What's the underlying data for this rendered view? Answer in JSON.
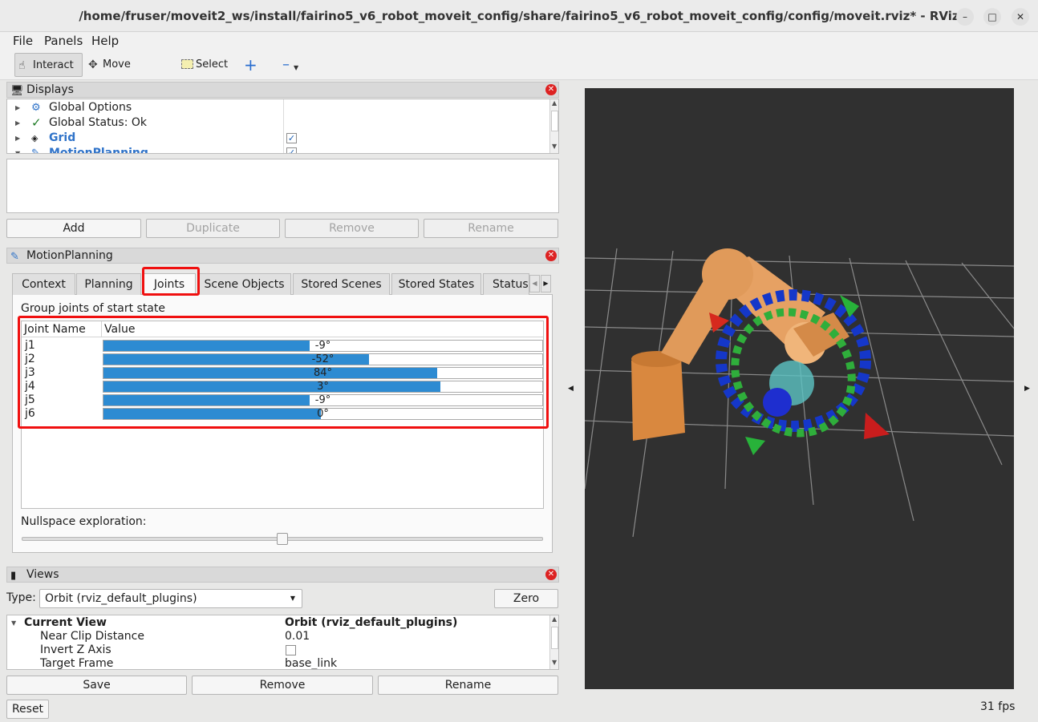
{
  "window": {
    "title": "/home/fruser/moveit2_ws/install/fairino5_v6_robot_moveit_config/share/fairino5_v6_robot_moveit_config/config/moveit.rviz* - RViz"
  },
  "menu": {
    "file": "File",
    "panels": "Panels",
    "help": "Help"
  },
  "toolbar": {
    "interact": "Interact",
    "move_camera": "Move Camera",
    "select": "Select",
    "add_icon": "plus-icon",
    "remove_icon": "minus-icon"
  },
  "displays": {
    "title": "Displays",
    "items": [
      {
        "label": "Global Options",
        "icon": "gear-icon",
        "checked": null
      },
      {
        "label": "Global Status: Ok",
        "icon": "checkmark-icon",
        "checked": null
      },
      {
        "label": "Grid",
        "icon": "grid-icon",
        "checked": true
      },
      {
        "label": "MotionPlanning",
        "icon": "motionplanning-icon",
        "checked": true
      }
    ],
    "buttons": {
      "add": "Add",
      "duplicate": "Duplicate",
      "remove": "Remove",
      "rename": "Rename"
    }
  },
  "motion_planning": {
    "title": "MotionPlanning",
    "tabs": [
      "Context",
      "Planning",
      "Joints",
      "Scene Objects",
      "Stored Scenes",
      "Stored States",
      "Status"
    ],
    "selected_tab": "Joints",
    "group_label": "Group joints of start state",
    "columns": {
      "name": "Joint Name",
      "value": "Value"
    },
    "joints": [
      {
        "name": "j1",
        "value": "-9°",
        "fill": 0.47
      },
      {
        "name": "j2",
        "value": "-52°",
        "fill": 0.605
      },
      {
        "name": "j3",
        "value": "84°",
        "fill": 0.76
      },
      {
        "name": "j4",
        "value": "3°",
        "fill": 0.767
      },
      {
        "name": "j5",
        "value": "-9°",
        "fill": 0.47
      },
      {
        "name": "j6",
        "value": "0°",
        "fill": 0.495
      }
    ],
    "nullspace_label": "Nullspace exploration:",
    "nullspace_level": 0.5
  },
  "views": {
    "title": "Views",
    "type_label": "Type:",
    "type_value": "Orbit (rviz_default_plugins)",
    "zero": "Zero",
    "current_view": {
      "label": "Current View",
      "value": "Orbit (rviz_default_plugins)"
    },
    "properties": [
      {
        "label": "Near Clip Distance",
        "value": "0.01"
      },
      {
        "label": "Invert Z Axis",
        "value": ""
      },
      {
        "label": "Target Frame",
        "value": "base_link"
      }
    ],
    "buttons": {
      "save": "Save",
      "remove": "Remove",
      "rename": "Rename"
    }
  },
  "bottom": {
    "reset": "Reset",
    "fps": "31 fps"
  },
  "colors": {
    "accent_bar": "#2d8bd2",
    "highlight": "#f01010",
    "viewport_bg": "#303030",
    "robot": "#e09a5a"
  }
}
